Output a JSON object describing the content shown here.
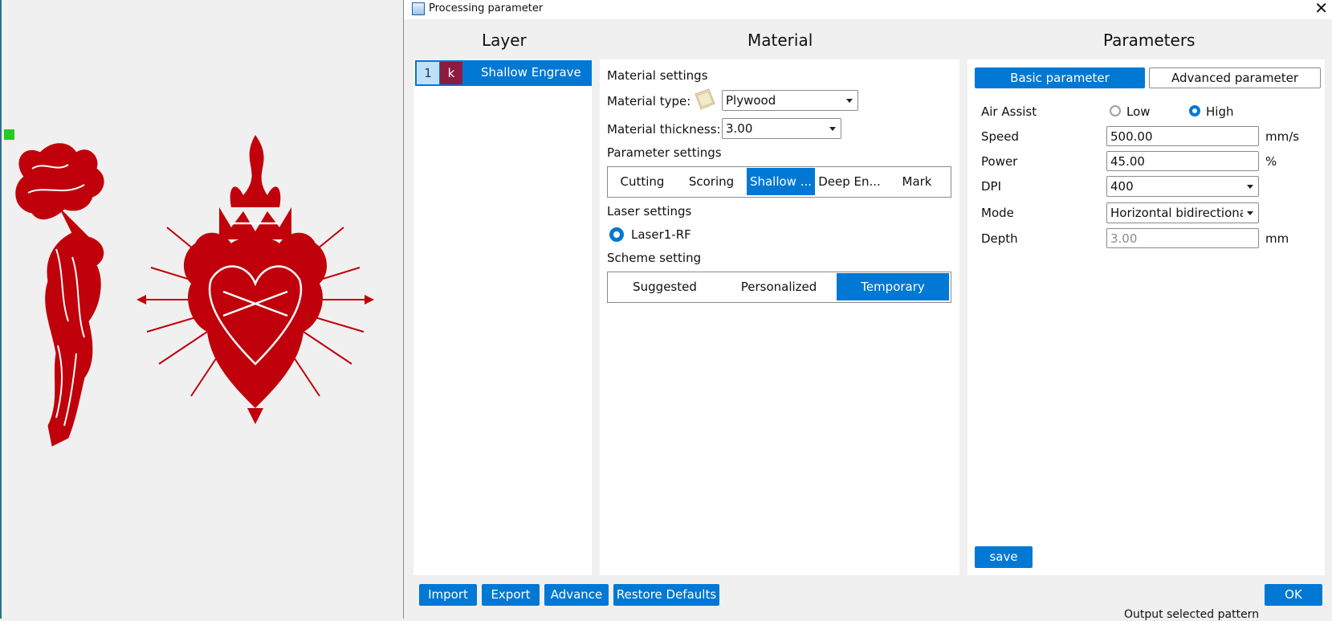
{
  "window": {
    "title": "Processing parameter",
    "close_label": "✕"
  },
  "headers": {
    "layer": "Layer",
    "material": "Material",
    "parameters": "Parameters"
  },
  "layer": {
    "number": "1",
    "mode_letter": "k",
    "name": "Shallow Engrave",
    "mode_color": "#8d1a3f"
  },
  "material": {
    "section_title": "Material settings",
    "type_label": "Material type:",
    "type_value": "Plywood",
    "thickness_label": "Material thickness:",
    "thickness_value": "3.00",
    "param_section_title": "Parameter settings",
    "param_tabs": [
      "Cutting",
      "Scoring",
      "Shallow ...",
      "Deep En...",
      "Mark"
    ],
    "param_tab_active": 2,
    "laser_section_title": "Laser settings",
    "laser_option": "Laser1-RF",
    "scheme_section_title": "Scheme setting",
    "scheme_tabs": [
      "Suggested",
      "Personalized",
      "Temporary"
    ],
    "scheme_tab_active": 2
  },
  "parameters": {
    "tabs": [
      "Basic parameter",
      "Advanced parameter"
    ],
    "tab_active": 0,
    "air_assist": {
      "label": "Air Assist",
      "options": [
        "Low",
        "High"
      ],
      "selected": "High"
    },
    "speed": {
      "label": "Speed",
      "value": "500.00",
      "unit": "mm/s"
    },
    "power": {
      "label": "Power",
      "value": "45.00",
      "unit": "%"
    },
    "dpi": {
      "label": "DPI",
      "value": "400"
    },
    "mode": {
      "label": "Mode",
      "value": "Horizontal bidirectional"
    },
    "depth": {
      "label": "Depth",
      "value": "3.00",
      "unit": "mm"
    },
    "save_label": "save"
  },
  "footer": {
    "import": "Import",
    "export": "Export",
    "advance": "Advance",
    "restore": "Restore Defaults",
    "ok": "OK"
  },
  "background_text": "Output selected pattern",
  "colors": {
    "accent": "#0078d4",
    "art_red": "#c0000a"
  }
}
